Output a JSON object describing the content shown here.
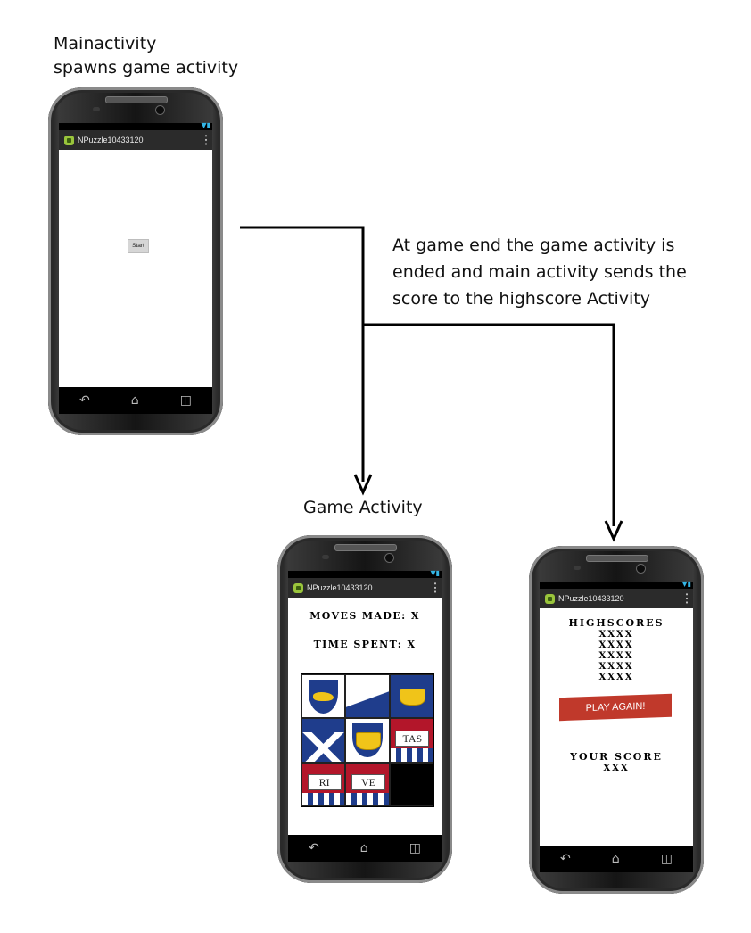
{
  "captions": {
    "main": [
      "Mainactivity",
      "spawns game activity"
    ],
    "flow": [
      "At game end the game activity is",
      "ended and main activity sends the",
      "score to the highscore Activity"
    ],
    "game": "Game Activity"
  },
  "app_title": "NPuzzle10433120",
  "main_screen": {
    "start_label": "Start"
  },
  "game_screen": {
    "moves_label": "MOVES MADE: X",
    "time_label": "TIME SPENT: X",
    "tiles": [
      {
        "kind": "lamp"
      },
      {
        "kind": "blank"
      },
      {
        "kind": "basket-shield"
      },
      {
        "kind": "chevron"
      },
      {
        "kind": "basket"
      },
      {
        "kind": "book",
        "text": "TAS"
      },
      {
        "kind": "book",
        "text": "RI"
      },
      {
        "kind": "book",
        "text": "VE"
      },
      {
        "kind": "empty"
      }
    ]
  },
  "highscore_screen": {
    "title": "HIGHSCORES",
    "entries": [
      "XXXX",
      "XXXX",
      "XXXX",
      "XXXX",
      "XXXX"
    ],
    "play_again_label": "PLAY AGAIN!",
    "your_score_label": "YOUR SCORE",
    "your_score_value": "XXX"
  },
  "colors": {
    "button_red": "#c0392b",
    "crest_blue": "#1f3d8c",
    "crest_gold": "#f0c419",
    "crest_red": "#b3162a"
  }
}
